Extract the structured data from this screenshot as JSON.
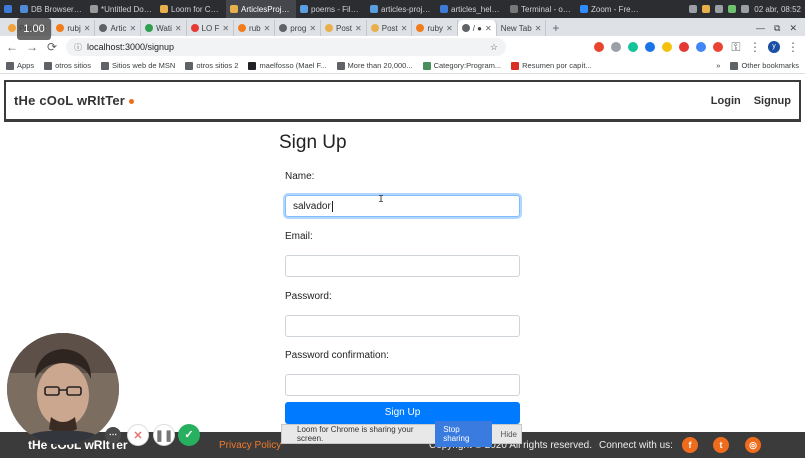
{
  "taskbar": {
    "tasks": [
      {
        "label": "DB Browser f...",
        "color": "#4f8bd6"
      },
      {
        "label": "*Untitled Doc...",
        "color": "#9a9a9a"
      },
      {
        "label": "Loom for Chr...",
        "color": "#e8b04a"
      },
      {
        "label": "ArticlesProjec...",
        "color": "#e8b04a"
      },
      {
        "label": "poems - File ...",
        "color": "#5a9ee0"
      },
      {
        "label": "articles-proje...",
        "color": "#5a9ee0"
      },
      {
        "label": "articles_helpe...",
        "color": "#3e7ad8"
      },
      {
        "label": "Terminal - os...",
        "color": "#777777"
      },
      {
        "label": "Zoom - Free ...",
        "color": "#2d8cff"
      }
    ],
    "clock": "02 abr, 08:52"
  },
  "tabs": [
    {
      "label": "Proje",
      "color": "#f2a33a"
    },
    {
      "label": "rubj",
      "color": "#f27c1c"
    },
    {
      "label": "Artic",
      "color": "#5f6368"
    },
    {
      "label": "Wati",
      "color": "#2e9e4f"
    },
    {
      "label": "LO F",
      "color": "#e53935"
    },
    {
      "label": "rub",
      "color": "#f27c1c"
    },
    {
      "label": "prog",
      "color": "#5f6368"
    },
    {
      "label": "Post",
      "color": "#e8b04a"
    },
    {
      "label": "Post",
      "color": "#e8b04a"
    },
    {
      "label": "ruby",
      "color": "#f27c1c"
    },
    {
      "label": "/ ●",
      "color": "#5f6368",
      "active": true
    },
    {
      "label": "New Tab",
      "color": ""
    }
  ],
  "new_tab_symbol": "+",
  "window_controls": {
    "minimize": "—",
    "maximize": "⧉",
    "close": "✕"
  },
  "address": {
    "url": "localhost:3000/signup"
  },
  "profile_initial": "y",
  "bookmarks": [
    {
      "label": "Apps",
      "color": "#5f6368"
    },
    {
      "label": "otros sitios",
      "color": "#5f6368"
    },
    {
      "label": "Sitios web de MSN",
      "color": "#5f6368"
    },
    {
      "label": "otros sitios 2",
      "color": "#5f6368"
    },
    {
      "label": "maelfosso (Mael F...",
      "color": "#202124"
    },
    {
      "label": "More than 20,000...",
      "color": "#5f6368"
    },
    {
      "label": "Category:Program...",
      "color": "#4a8f5c"
    },
    {
      "label": "Resumen por capít...",
      "color": "#d93025"
    }
  ],
  "bookmarks_overflow": "»",
  "bookmarks_other": "Other bookmarks",
  "site": {
    "brand": "tHe cOoL wRItTer",
    "nav": {
      "login": "Login",
      "signup": "Signup"
    }
  },
  "form": {
    "title": "Sign Up",
    "name_label": "Name:",
    "name_value": "salvador",
    "email_label": "Email:",
    "password_label": "Password:",
    "password_confirmation_label": "Password confirmation:",
    "submit_label": "Sign Up"
  },
  "footer": {
    "brand": "tHe cOoL wRItTer",
    "privacy": "Privacy Policy",
    "copyright": "Copyright © 2020 All rights reserved.",
    "connect": "Connect with us:",
    "social": [
      "f",
      "t",
      "◎"
    ]
  },
  "share_bar": {
    "message": "Loom for Chrome is sharing your screen.",
    "stop": "Stop sharing",
    "hide": "Hide"
  },
  "recorder": {
    "speed": "1.00"
  }
}
